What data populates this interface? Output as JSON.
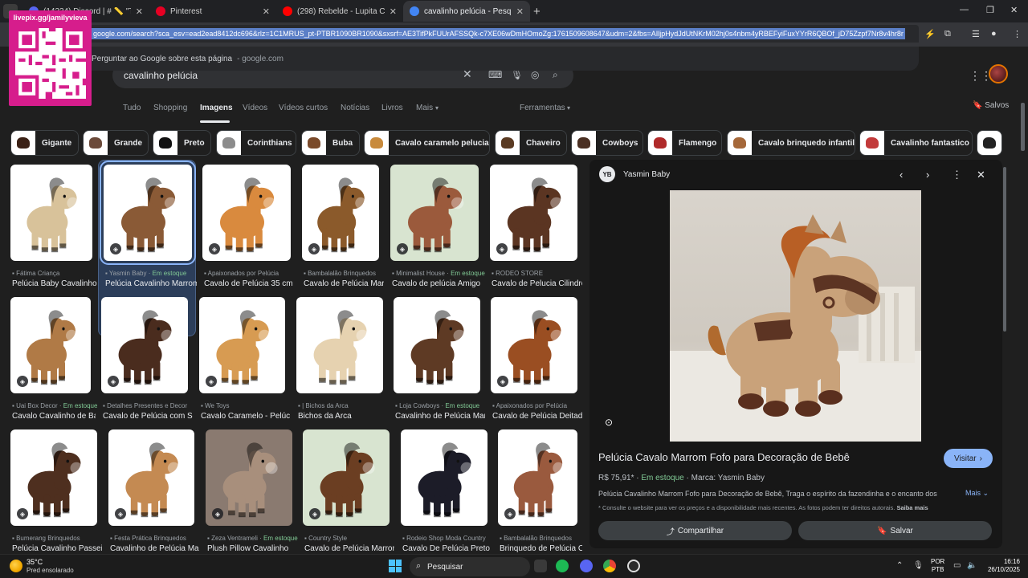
{
  "browser": {
    "tabs": [
      {
        "title": "(14234) Discord | # 📏 \"Tamanh",
        "favicon_color": "#5865f2",
        "active": false
      },
      {
        "title": "Pinterest",
        "favicon_color": "#e60023",
        "active": false
      },
      {
        "title": "(298) Rebelde - Lupita Cantand",
        "favicon_color": "#ff0000",
        "active": false
      },
      {
        "title": "cavalinho pelúcia - Pesquisa Go",
        "favicon_color": "#4285f4",
        "active": true
      }
    ],
    "url": "google.com/search?sca_esv=ead2ead8412dc696&rlz=1C1MRUS_pt-PTBR1090BR1090&sxsrf=AE3TifPkFUUrAFSSQk-c7XE06wDmHOmoZg:1761509608647&udm=2&fbs=AIljpHydJdUtNKrM02hj0s4nbm4yRBEFyiFuxYYrR6QBOf_jD75Zzpf7Nr8v4hr8r",
    "omnibox_suggestion": "Perguntar ao Google sobre esta página",
    "omnibox_suggestion_sub": "- google.com",
    "overlay_label": "livepix.gg/jamilyvieva"
  },
  "search": {
    "query": "cavalinho pelúcia",
    "nav_tabs": [
      "Tudo",
      "Shopping",
      "Imagens",
      "Vídeos",
      "Vídeos curtos",
      "Notícias",
      "Livros",
      "Mais"
    ],
    "tools": "Ferramentas",
    "saved": "Salvos"
  },
  "chips": [
    "Gigante",
    "Grande",
    "Preto",
    "Corinthians",
    "Buba",
    "Cavalo caramelo pelucia",
    "Chaveiro",
    "Cowboys",
    "Flamengo",
    "Cavalo brinquedo infantil",
    "Cavalinho fantastico"
  ],
  "results": [
    {
      "source": "Fátima Criança",
      "stock": "",
      "title": "Pelúcia Baby Cavalinho",
      "color": "#d8c29a"
    },
    {
      "source": "Yasmin Baby",
      "stock": "Em estoque",
      "title": "Pelúcia Cavalinho Marrom",
      "color": "#8a5a36"
    },
    {
      "source": "Apaixonados por Pelúcia",
      "stock": "",
      "title": "Cavalo de Pelúcia 35 cm",
      "color": "#d98a3e"
    },
    {
      "source": "Bambalalão Brinquedos",
      "stock": "",
      "title": "Cavalo de Pelúcia Marrom",
      "color": "#8b5a2b"
    },
    {
      "source": "Minimalist House",
      "stock": "Em estoque",
      "title": "Cavalo de pelúcia Amigo",
      "color": "#9b5a3c"
    },
    {
      "source": "RODEO STORE",
      "stock": "",
      "title": "Cavalo de Pelucia Cilindro",
      "color": "#5b3522"
    },
    {
      "source": "Uai Box Decor",
      "stock": "Em estoque",
      "title": "Cavalo Cavalinho de Balanço",
      "color": "#b07a46"
    },
    {
      "source": "Detalhes Presentes e Decor",
      "stock": "",
      "title": "Cavalo de Pelúcia com Som",
      "color": "#4a2c1e"
    },
    {
      "source": "We Toys",
      "stock": "",
      "title": "Cavalo Caramelo - Pelúcia",
      "color": "#d79b52"
    },
    {
      "source": "| Bichos da Arca",
      "stock": "",
      "title": "Bichos da Arca",
      "color": "#e6d2b0"
    },
    {
      "source": "Loja Cowboys",
      "stock": "Em estoque",
      "title": "Cavalinho de Pelúcia Marrom",
      "color": "#5e3a24"
    },
    {
      "source": "Apaixonados por Pelúcia",
      "stock": "",
      "title": "Cavalo de Pelúcia Deitado",
      "color": "#9a4e22"
    },
    {
      "source": "Bumerang Brinquedos",
      "stock": "",
      "title": "Pelúcia Cavalinho Passeio",
      "color": "#4e2f1f"
    },
    {
      "source": "Festa Prática Brinquedos",
      "stock": "",
      "title": "Cavalinho de Pelúcia Marrom",
      "color": "#c48a52"
    },
    {
      "source": "Zeza Ventrameli",
      "stock": "Em estoque",
      "title": "Plush Pillow Cavalinho",
      "color": "#a88f7c"
    },
    {
      "source": "Country Style",
      "stock": "",
      "title": "Cavalo de Pelúcia Marrom",
      "color": "#6b3e22"
    },
    {
      "source": "Rodeio Shop Moda Country",
      "stock": "",
      "title": "Cavalo De Pelúcia Preto",
      "color": "#1c1c28"
    },
    {
      "source": "Bambalalão Brinquedos",
      "stock": "",
      "title": "Brinquedo de Pelúcia Cavalo",
      "color": "#9a5a3e"
    }
  ],
  "preview": {
    "publisher_logo": "YB",
    "publisher": "Yasmin Baby",
    "title": "Pelúcia Cavalo Marrom Fofo para Decoração de Bebê",
    "visit": "Visitar",
    "price": "R$ 75,91*",
    "stock": "Em estoque",
    "brand": "Marca: Yasmin Baby",
    "description": "Pelúcia Cavalinho Marrom Fofo para Decoração de Bebê, Traga o espírito da fazendinha e o encanto dos",
    "more": "Mais",
    "note": "* Consulte o website para ver os preços e a disponibilidade mais recentes. As fotos podem ter direitos autorais.",
    "note_link": "Saiba mais",
    "share": "Compartilhar",
    "save": "Salvar"
  },
  "taskbar": {
    "temp": "35°C",
    "weather": "Pred ensolarado",
    "search": "Pesquisar",
    "lang1": "POR",
    "lang2": "PTB",
    "time": "16:16",
    "date": "26/10/2025"
  }
}
